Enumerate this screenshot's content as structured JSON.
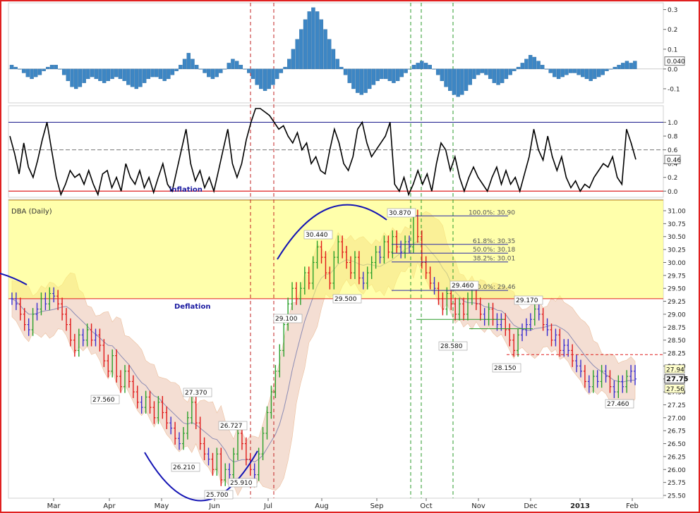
{
  "chart_data": [
    {
      "type": "bar",
      "panel": "oscillator",
      "y_ticks": [
        "0.3",
        "0.2",
        "0.1",
        "0.0",
        "-0.1"
      ],
      "ylim": [
        -0.15,
        0.32
      ],
      "current_value": "0.040",
      "color": "#3d86c4",
      "values": [
        0.02,
        0.01,
        0.0,
        -0.02,
        -0.04,
        -0.05,
        -0.04,
        -0.03,
        -0.01,
        0.01,
        0.02,
        0.02,
        0.0,
        -0.03,
        -0.06,
        -0.09,
        -0.1,
        -0.09,
        -0.07,
        -0.05,
        -0.04,
        -0.05,
        -0.06,
        -0.07,
        -0.06,
        -0.05,
        -0.04,
        -0.05,
        -0.06,
        -0.08,
        -0.09,
        -0.1,
        -0.09,
        -0.07,
        -0.05,
        -0.04,
        -0.04,
        -0.05,
        -0.06,
        -0.05,
        -0.03,
        -0.01,
        0.02,
        0.05,
        0.08,
        0.05,
        0.02,
        0.0,
        -0.02,
        -0.04,
        -0.05,
        -0.04,
        -0.02,
        0.0,
        0.03,
        0.05,
        0.04,
        0.02,
        0.0,
        -0.02,
        -0.05,
        -0.08,
        -0.1,
        -0.11,
        -0.1,
        -0.08,
        -0.05,
        -0.02,
        0.01,
        0.05,
        0.1,
        0.15,
        0.2,
        0.25,
        0.29,
        0.31,
        0.29,
        0.25,
        0.2,
        0.15,
        0.1,
        0.05,
        0.01,
        -0.03,
        -0.07,
        -0.1,
        -0.12,
        -0.13,
        -0.12,
        -0.1,
        -0.08,
        -0.06,
        -0.05,
        -0.05,
        -0.06,
        -0.07,
        -0.06,
        -0.04,
        -0.02,
        0.0,
        0.02,
        0.03,
        0.04,
        0.03,
        0.02,
        0.0,
        -0.03,
        -0.06,
        -0.09,
        -0.11,
        -0.13,
        -0.14,
        -0.13,
        -0.11,
        -0.08,
        -0.05,
        -0.03,
        -0.02,
        -0.03,
        -0.05,
        -0.07,
        -0.08,
        -0.07,
        -0.05,
        -0.03,
        -0.01,
        0.01,
        0.03,
        0.05,
        0.07,
        0.06,
        0.04,
        0.02,
        0.0,
        -0.02,
        -0.04,
        -0.05,
        -0.04,
        -0.03,
        -0.02,
        -0.02,
        -0.03,
        -0.04,
        -0.05,
        -0.06,
        -0.05,
        -0.04,
        -0.03,
        -0.01,
        0.0,
        0.01,
        0.02,
        0.03,
        0.04,
        0.03,
        0.04
      ]
    },
    {
      "type": "line",
      "panel": "stochastic",
      "y_ticks": [
        "1.0",
        "0.8",
        "0.6",
        "0.4",
        "0.2",
        "0.0"
      ],
      "ylim": [
        -0.12,
        1.2
      ],
      "current_value": "0.46",
      "reference_lines": {
        "upper": 1.0,
        "middle": 0.6,
        "lower": 0.0
      },
      "annotation": "inflation",
      "color": "#000000",
      "values": [
        0.8,
        0.55,
        0.25,
        0.7,
        0.35,
        0.2,
        0.45,
        0.75,
        1.0,
        0.6,
        0.2,
        -0.05,
        0.1,
        0.3,
        0.2,
        0.25,
        0.1,
        0.3,
        0.1,
        -0.05,
        0.25,
        0.3,
        0.05,
        0.2,
        0.0,
        0.4,
        0.2,
        0.1,
        0.3,
        0.05,
        0.2,
        -0.02,
        0.2,
        0.4,
        0.1,
        0.0,
        0.3,
        0.6,
        0.9,
        0.4,
        0.15,
        0.3,
        0.05,
        0.2,
        0.0,
        0.3,
        0.6,
        0.9,
        0.4,
        0.2,
        0.4,
        0.75,
        1.0,
        1.2,
        1.2,
        1.15,
        1.1,
        1.0,
        0.9,
        0.95,
        0.8,
        0.7,
        0.85,
        0.6,
        0.7,
        0.4,
        0.5,
        0.3,
        0.25,
        0.6,
        0.9,
        0.7,
        0.4,
        0.3,
        0.5,
        0.9,
        1.0,
        0.7,
        0.5,
        0.6,
        0.7,
        0.8,
        1.0,
        0.1,
        0.0,
        0.2,
        -0.05,
        0.1,
        0.3,
        0.1,
        0.25,
        0.0,
        0.4,
        0.7,
        0.6,
        0.3,
        0.5,
        0.2,
        0.0,
        0.2,
        0.35,
        0.2,
        0.1,
        0.0,
        0.2,
        0.35,
        0.1,
        0.3,
        0.1,
        0.2,
        0.0,
        0.25,
        0.5,
        0.9,
        0.6,
        0.45,
        0.8,
        0.5,
        0.3,
        0.5,
        0.2,
        0.05,
        0.15,
        0.0,
        0.1,
        0.05,
        0.2,
        0.3,
        0.4,
        0.35,
        0.5,
        0.2,
        0.1,
        0.9,
        0.7,
        0.46
      ]
    },
    {
      "type": "candlestick",
      "panel": "price",
      "title": "DBA (Daily)",
      "ylim": [
        25.5,
        31.15
      ],
      "y_ticks": [
        "31.00",
        "30.75",
        "30.50",
        "30.25",
        "30.00",
        "29.75",
        "29.50",
        "29.25",
        "29.00",
        "28.75",
        "28.50",
        "28.25",
        "28.00",
        "27.75",
        "27.50",
        "27.25",
        "27.00",
        "26.75",
        "26.50",
        "26.25",
        "26.00",
        "25.75",
        "25.50"
      ],
      "x_labels": [
        "Mar",
        "Apr",
        "May",
        "Jun",
        "Jul",
        "Aug",
        "Sep",
        "Oct",
        "Nov",
        "Dec",
        "2013",
        "Feb"
      ],
      "price_tags": [
        {
          "label": "27.94",
          "value": 27.94
        },
        {
          "label": "27.75",
          "value": 27.75
        },
        {
          "label": "27.56",
          "value": 27.56
        }
      ],
      "zone_labels": [
        {
          "label": "inflation"
        },
        {
          "label": "Deflation"
        }
      ],
      "fibonacci": [
        {
          "label": "100.0%: 30.90",
          "value": 30.9
        },
        {
          "label": "61.8%: 30.35",
          "value": 30.35
        },
        {
          "label": "50.0%: 30.18",
          "value": 30.18
        },
        {
          "label": "38.2%: 30.01",
          "value": 30.01
        },
        {
          "label": "0.0%: 29.46",
          "value": 29.46
        }
      ],
      "price_labels": [
        {
          "label": "27.560",
          "value": 27.56
        },
        {
          "label": "27.370",
          "value": 27.37
        },
        {
          "label": "26.210",
          "value": 26.21
        },
        {
          "label": "26.727",
          "value": 26.727
        },
        {
          "label": "25.910",
          "value": 25.91
        },
        {
          "label": "25.700",
          "value": 25.7
        },
        {
          "label": "30.440",
          "value": 30.44
        },
        {
          "label": "29.100",
          "value": 29.1
        },
        {
          "label": "29.500",
          "value": 29.5
        },
        {
          "label": "30.870",
          "value": 30.87
        },
        {
          "label": "29.460",
          "value": 29.46
        },
        {
          "label": "28.580",
          "value": 28.58
        },
        {
          "label": "29.170",
          "value": 29.17
        },
        {
          "label": "28.150",
          "value": 28.15
        },
        {
          "label": "27.460",
          "value": 27.46
        }
      ],
      "colors": {
        "up": "#2aa02a",
        "down": "#e01818",
        "neutral": "#3a2ed0",
        "band": "#f3d9cc",
        "zone": "#ffff66"
      },
      "closes": [
        29.3,
        29.2,
        29.0,
        28.8,
        28.7,
        29.0,
        29.1,
        29.3,
        29.2,
        29.4,
        29.35,
        29.2,
        29.0,
        28.8,
        28.5,
        28.3,
        28.6,
        28.5,
        28.7,
        28.5,
        28.6,
        28.4,
        28.1,
        27.9,
        28.2,
        27.8,
        27.6,
        27.9,
        27.7,
        27.5,
        27.3,
        27.2,
        27.4,
        27.2,
        27.0,
        27.3,
        27.1,
        26.9,
        26.8,
        26.6,
        26.5,
        26.7,
        27.0,
        27.3,
        26.9,
        26.5,
        26.3,
        26.2,
        26.0,
        26.3,
        25.8,
        26.0,
        25.9,
        26.3,
        26.7,
        26.5,
        26.2,
        26.0,
        25.9,
        26.3,
        26.7,
        27.1,
        27.5,
        27.9,
        28.3,
        28.8,
        29.2,
        29.5,
        29.3,
        29.5,
        29.8,
        29.6,
        30.0,
        30.3,
        30.1,
        29.8,
        29.6,
        30.1,
        30.4,
        30.2,
        30.0,
        29.8,
        30.1,
        29.7,
        29.6,
        29.8,
        30.0,
        30.2,
        30.1,
        30.4,
        30.2,
        30.5,
        30.3,
        30.2,
        30.4,
        30.3,
        30.9,
        30.5,
        30.0,
        29.8,
        29.6,
        29.5,
        29.3,
        29.1,
        29.4,
        29.2,
        29.0,
        29.2,
        29.0,
        29.3,
        29.5,
        29.2,
        29.0,
        28.9,
        29.1,
        28.9,
        28.8,
        28.9,
        28.7,
        28.5,
        28.3,
        28.6,
        28.7,
        28.8,
        28.9,
        29.1,
        29.0,
        28.8,
        28.7,
        28.5,
        28.6,
        28.3,
        28.4,
        28.3,
        28.1,
        28.0,
        27.9,
        27.7,
        27.6,
        27.8,
        27.7,
        27.9,
        27.8,
        27.6,
        27.5,
        27.7,
        27.6,
        27.8,
        27.9,
        27.75
      ]
    }
  ]
}
